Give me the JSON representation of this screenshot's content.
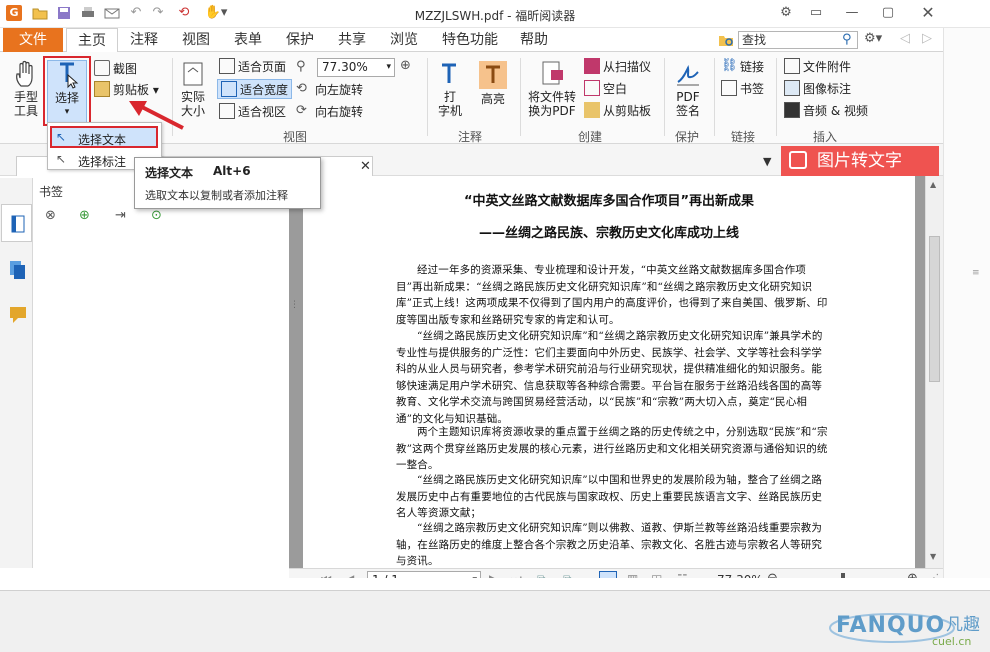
{
  "app": {
    "title": "MZZJLSWH.pdf - 福昕阅读器"
  },
  "quick_access": {
    "icons": [
      "app-logo-icon",
      "open-folder-icon",
      "save-icon",
      "print-icon",
      "email-icon",
      "undo-icon",
      "redo-icon",
      "hand-tool-icon"
    ]
  },
  "tabs": [
    {
      "label": "文件"
    },
    {
      "label": "主页"
    },
    {
      "label": "注释"
    },
    {
      "label": "视图"
    },
    {
      "label": "表单"
    },
    {
      "label": "保护"
    },
    {
      "label": "共享"
    },
    {
      "label": "浏览"
    },
    {
      "label": "特色功能"
    },
    {
      "label": "帮助"
    }
  ],
  "search": {
    "placeholder": "查找"
  },
  "ribbon": {
    "hand_tool": "手型\n工具",
    "select": "选择",
    "screenshot": "截图",
    "clipboard": "剪贴板",
    "actual_size": "实际\n大小",
    "fit_page": "适合页面",
    "fit_width": "适合宽度",
    "fit_visible": "适合视区",
    "zoom_value": "77.30%",
    "rotate_left": "向左旋转",
    "rotate_right": "向右旋转",
    "typewriter": "打\n字机",
    "highlight": "高亮",
    "convert_pdf": "将文件转\n换为PDF",
    "from_scanner": "从扫描仪",
    "blank": "空白",
    "from_clipboard": "从剪贴板",
    "pdf_sign": "PDF\n签名",
    "link": "链接",
    "bookmark": "书签",
    "file_attach": "文件附件",
    "image_annot": "图像标注",
    "audio_video": "音频 & 视频",
    "groups": {
      "view": "视图",
      "comment": "注释",
      "create": "创建",
      "protect": "保护",
      "link": "链接",
      "insert": "插入"
    }
  },
  "dropdown": {
    "select_text": "选择文本",
    "select_annot": "选择标注"
  },
  "tooltip": {
    "title": "选择文本",
    "shortcut": "Alt+6",
    "desc": "选取文本以复制或者添加注释"
  },
  "promo": {
    "label": "图片转文字"
  },
  "bookmarks": {
    "header": "书签"
  },
  "document": {
    "title1": "“中英文丝路文献数据库多国合作项目”再出新成果",
    "title2": "——丝绸之路民族、宗教历史文化库成功上线",
    "paragraphs": [
      "经过一年多的资源采集、专业梳理和设计开发，“中英文丝路文献数据库多国合作项目”再出新成果：“丝绸之路民族历史文化研究知识库”和“丝绸之路宗教历史文化研究知识库”正式上线！这两项成果不仅得到了国内用户的高度评价，也得到了来自美国、俄罗斯、印度等国出版专家和丝路研究专家的肯定和认可。",
      "“丝绸之路民族历史文化研究知识库”和“丝绸之路宗教历史文化研究知识库”兼具学术的专业性与提供服务的广泛性：它们主要面向中外历史、民族学、社会学、文学等社会科学学科的从业人员与研究者，参考学术研究前沿与行业研究现状，提供精准细化的知识服务。能够快速满足用户学术研究、信息获取等各种综合需要。平台旨在服务于丝路沿线各国的高等教育、文化学术交流与跨国贸易经营活动，以“民族”和“宗教”两大切入点，奠定“民心相通”的文化与知识基础。",
      "两个主题知识库将资源收录的重点置于丝绸之路的历史传统之中，分别选取“民族”和“宗教”这两个贯穿丝路历史发展的核心元素，进行丝路历史和文化相关研究资源与通俗知识的统一整合。",
      "“丝绸之路民族历史文化研究知识库”以中国和世界史的发展阶段为轴，整合了丝绸之路发展历史中占有重要地位的古代民族与国家政权、历史上重要民族语言文字、丝路民族历史名人等资源文献；",
      "“丝绸之路宗教历史文化研究知识库”则以佛教、道教、伊斯兰教等丝路沿线重要宗教为轴，在丝路历史的维度上整合各个宗教之历史沿革、宗教文化、名胜古迹与宗教名人等研究与资讯。"
    ]
  },
  "status": {
    "page_field": "1 / 1",
    "zoom": "77.30%"
  },
  "watermark": {
    "text": "FANQUO",
    "sub": "凡趣",
    "domain": "cuel.cn"
  },
  "colors": {
    "accent": "#e8731e",
    "highlight_red": "#d9272e",
    "promo_red": "#ef5350",
    "select_blue": "#cfe3fb"
  }
}
